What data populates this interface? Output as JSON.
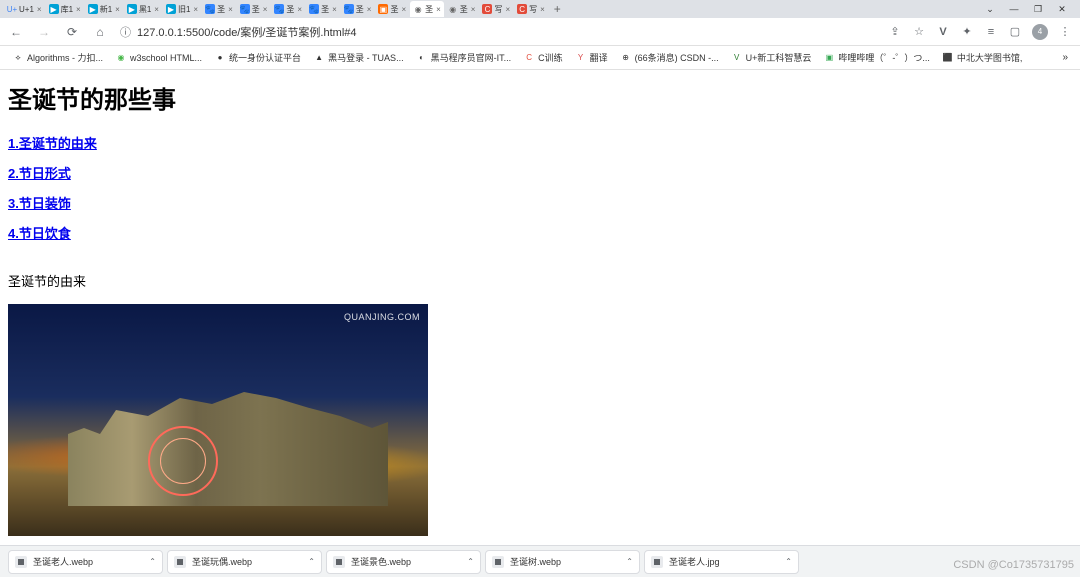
{
  "tabs": [
    {
      "icon": "U+",
      "color": "#4285f4",
      "bg": "",
      "label": "U+1"
    },
    {
      "icon": "▶",
      "color": "#fff",
      "bg": "#00a1d6",
      "label": "库1"
    },
    {
      "icon": "▶",
      "color": "#fff",
      "bg": "#00a1d6",
      "label": "新1"
    },
    {
      "icon": "▶",
      "color": "#fff",
      "bg": "#00a1d6",
      "label": "黑1"
    },
    {
      "icon": "▶",
      "color": "#fff",
      "bg": "#00a1d6",
      "label": "旧1"
    },
    {
      "icon": "🐾",
      "color": "#fff",
      "bg": "#3385ff",
      "label": "圣"
    },
    {
      "icon": "🐾",
      "color": "#fff",
      "bg": "#3385ff",
      "label": "圣"
    },
    {
      "icon": "🐾",
      "color": "#fff",
      "bg": "#3385ff",
      "label": "圣"
    },
    {
      "icon": "🐾",
      "color": "#fff",
      "bg": "#3385ff",
      "label": "圣"
    },
    {
      "icon": "🐾",
      "color": "#fff",
      "bg": "#3385ff",
      "label": "圣"
    },
    {
      "icon": "▣",
      "color": "#fff",
      "bg": "#ff6a00",
      "label": "圣"
    },
    {
      "icon": "◉",
      "color": "#666",
      "bg": "",
      "label": "圣"
    },
    {
      "icon": "◉",
      "color": "#666",
      "bg": "",
      "label": "圣"
    },
    {
      "icon": "C",
      "color": "#fff",
      "bg": "#e24b3a",
      "label": "写"
    },
    {
      "icon": "C",
      "color": "#fff",
      "bg": "#e24b3a",
      "label": "写"
    }
  ],
  "active_tab_index": 11,
  "new_tab_label": "+",
  "window": {
    "min": "—",
    "max": "❐",
    "close": "✕",
    "dropdown": "⌄"
  },
  "nav": {
    "back": "←",
    "forward": "→",
    "reload": "⟳",
    "home": "⌂"
  },
  "url": "127.0.0.1:5500/code/案例/圣诞节案例.html#4",
  "url_proto_icon": "ⓘ",
  "toolbar_icons": {
    "share": "⇪",
    "star": "☆",
    "v": "V",
    "ext": "✦",
    "list": "≡",
    "panel": "▢",
    "acct": "4",
    "menu": "⋮"
  },
  "bookmarks": [
    {
      "icon": "⟡",
      "color": "#333",
      "label": "Algorithms - 力扣..."
    },
    {
      "icon": "◉",
      "color": "#47b749",
      "label": "w3school HTML..."
    },
    {
      "icon": "●",
      "color": "#333",
      "label": "统一身份认证平台"
    },
    {
      "icon": "▲",
      "color": "#333",
      "label": "黑马登录 - TUAS..."
    },
    {
      "icon": "◐",
      "color": "#333",
      "label": "黑马程序员官网-IT..."
    },
    {
      "icon": "C",
      "color": "#e24b3a",
      "label": "C训练"
    },
    {
      "icon": "Y",
      "color": "#d94b4b",
      "label": "翻译"
    },
    {
      "icon": "⊕",
      "color": "#333",
      "label": "(66条消息) CSDN -..."
    },
    {
      "icon": "V",
      "color": "#2e7d32",
      "label": "U+新工科智慧云"
    },
    {
      "icon": "▣",
      "color": "#34a853",
      "label": "哔哩哔哩（゜-゜）つ..."
    },
    {
      "icon": "⬛",
      "color": "#d9534f",
      "label": "中北大学图书馆,"
    }
  ],
  "bookmark_overflow": "»",
  "page": {
    "title": "圣诞节的那些事",
    "toc": [
      "1.圣诞节的由来",
      "2.节日形式",
      "3.节日装饰",
      "4.节日饮食"
    ],
    "section_heading": "圣诞节的由来",
    "image_watermark": "QUANJING.COM"
  },
  "downloads": [
    "圣诞老人.webp",
    "圣诞玩偶.webp",
    "圣诞景色.webp",
    "圣诞树.webp",
    "圣诞老人.jpg"
  ],
  "watermark": "CSDN @Co1735731795"
}
